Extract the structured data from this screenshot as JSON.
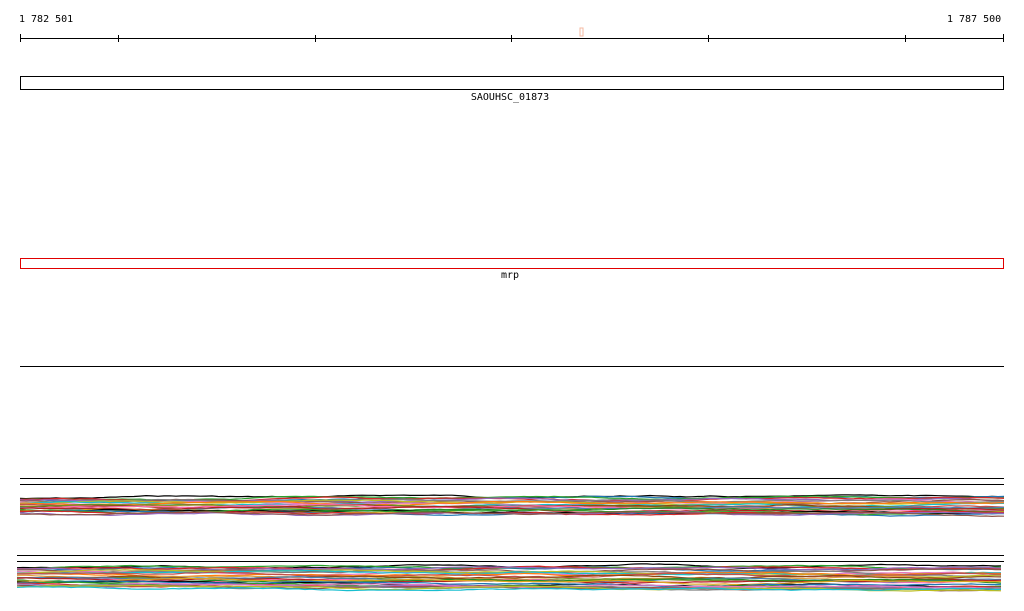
{
  "ruler": {
    "start_label": "1 782 501",
    "end_label": "1 787 500"
  },
  "tracks": {
    "gene_track": {
      "label": "SAOUHSC_01873"
    },
    "feature_track": {
      "label": "mrp",
      "color": "#e00000"
    }
  },
  "colors": {
    "ruler": "#000000",
    "marker": "#f4b8a0",
    "coverage_palette": [
      "#000000",
      "#1f77b4",
      "#2ca02c",
      "#d62728",
      "#9467bd",
      "#8c564b",
      "#e377c2",
      "#7f7f7f",
      "#bcbd22",
      "#17becf",
      "#ff7f0e",
      "#c0504d",
      "#e0a040",
      "#6b8e23",
      "#8b4513",
      "#ff69b4",
      "#4682b4",
      "#b22222",
      "#228b22",
      "#daa520"
    ]
  }
}
